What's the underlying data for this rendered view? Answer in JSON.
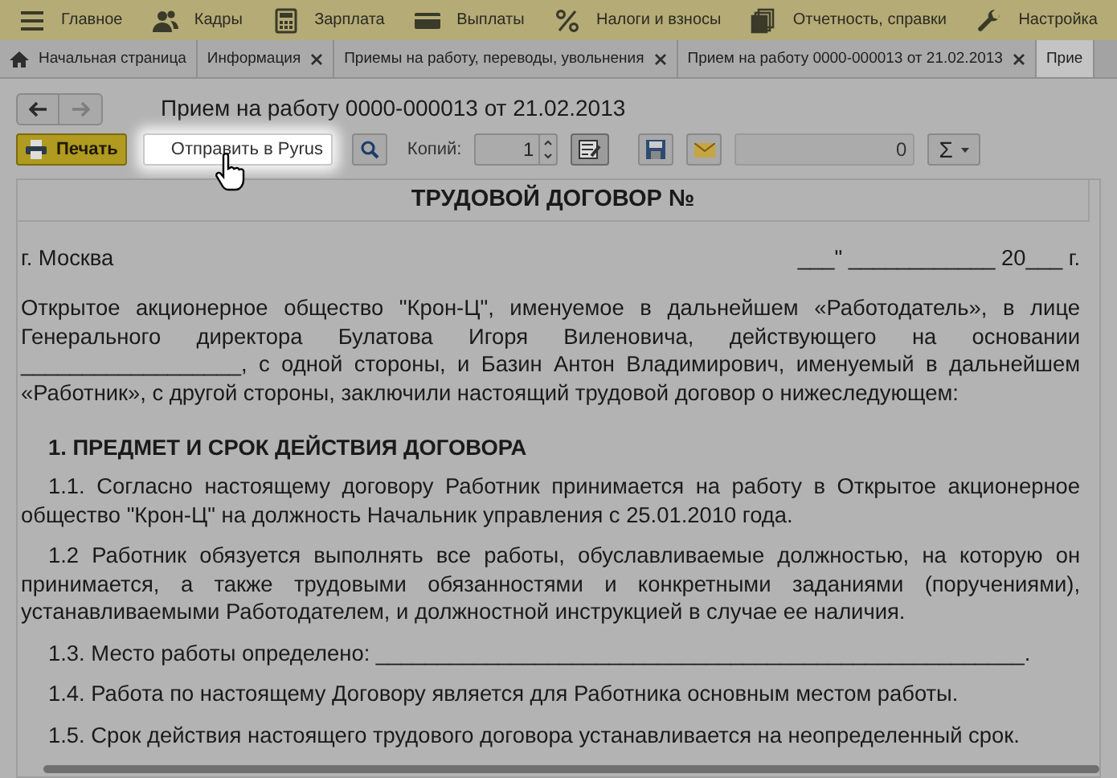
{
  "menu": [
    {
      "label": "Главное"
    },
    {
      "label": "Кадры"
    },
    {
      "label": "Зарплата"
    },
    {
      "label": "Выплаты"
    },
    {
      "label": "Налоги и взносы"
    },
    {
      "label": "Отчетность, справки"
    },
    {
      "label": "Настройка"
    }
  ],
  "tabs": [
    {
      "label": "Начальная страница",
      "kind": "home",
      "selected": false
    },
    {
      "label": "Информация",
      "kind": "closable",
      "selected": false
    },
    {
      "label": "Приемы на работу, переводы, увольнения",
      "kind": "closable",
      "selected": false
    },
    {
      "label": "Прием на работу 0000-000013 от 21.02.2013",
      "kind": "closable",
      "selected": false
    },
    {
      "label": "Прие",
      "kind": "plain",
      "selected": true
    }
  ],
  "form": {
    "title": "Прием на работу 0000-000013 от 21.02.2013",
    "print_button": "Печать",
    "send_button": "Отправить в Pyrus",
    "copies_label": "Копий:",
    "copies_value": "1",
    "total_value": "0",
    "sum_button": "Σ"
  },
  "document": {
    "heading": "ТРУДОВОЙ ДОГОВОР №",
    "city": "г. Москва",
    "date": "___\" ____________ 20___ г.",
    "paragraphs": [
      {
        "kind": "plain",
        "text": "Открытое акционерное общество \"Крон-Ц\", именуемое в дальнейшем «Работодатель», в лице Генерального директора Булатова Игоря Виленовича, действующего на основании __________________, с одной стороны, и Базин Антон Владимирович, именуемый в дальнейшем «Работник», с другой стороны, заключили настоящий трудовой договор о нижеследующем:"
      },
      {
        "kind": "section",
        "text": "1. ПРЕДМЕТ И СРОК ДЕЙСТВИЯ ДОГОВОРА"
      },
      {
        "kind": "clause",
        "text": "1.1. Согласно настоящему договору Работник принимается на работу в Открытое акционерное общество \"Крон-Ц\" на должность Начальник управления с 25.01.2010 года."
      },
      {
        "kind": "clause",
        "text": "1.2 Работник обязуется выполнять все работы, обуславливаемые должностью, на которую он принимается, а также трудовыми обязанностями и конкретными заданиями (поручениями), устанавливаемыми Работодателем, и должностной инструкцией в случае ее наличия."
      },
      {
        "kind": "clause",
        "text": "1.3. Место работы определено: _____________________________________________________."
      },
      {
        "kind": "clause",
        "text": "1.4. Работа по настоящему Договору является для Работника основным местом работы."
      },
      {
        "kind": "clause",
        "text": "1.5. Срок действия настоящего трудового договора устанавливается на неопределенный срок."
      }
    ]
  }
}
